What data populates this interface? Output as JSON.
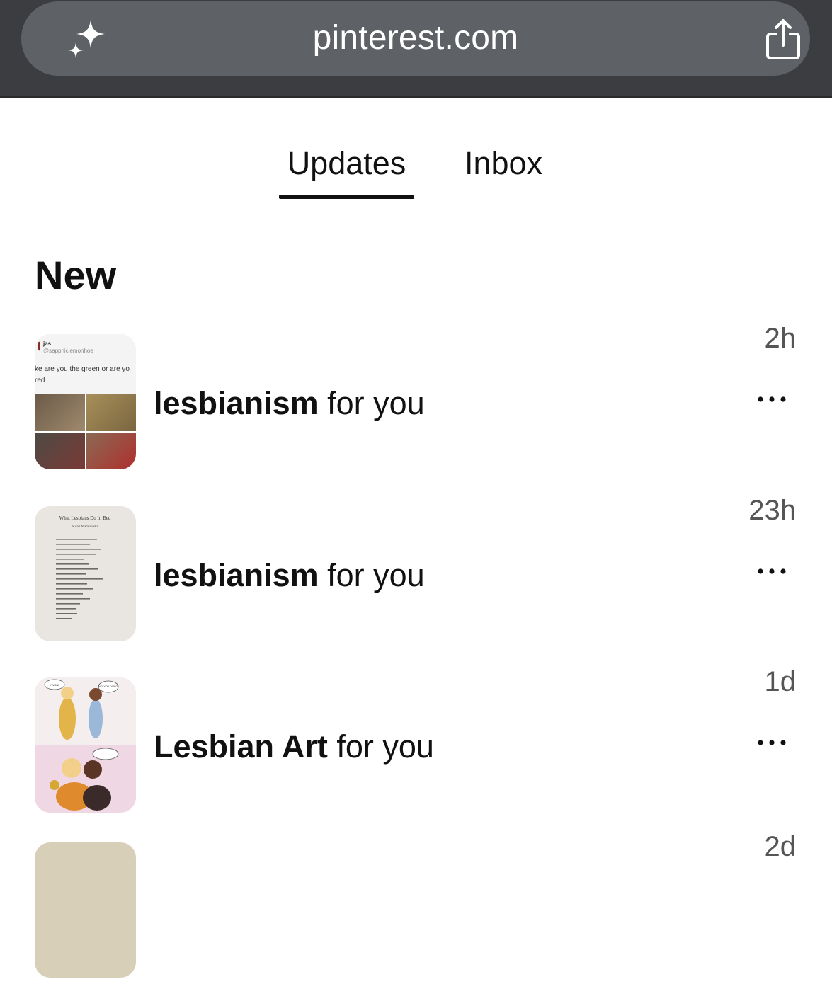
{
  "browser": {
    "url": "pinterest.com",
    "sparkle_icon": "sparkles-icon",
    "share_icon": "share-icon"
  },
  "tabs": [
    {
      "label": "Updates",
      "active": true
    },
    {
      "label": "Inbox",
      "active": false
    }
  ],
  "section": {
    "heading": "New"
  },
  "notifications": [
    {
      "board": "lesbianism",
      "suffix": "for you",
      "time": "2h"
    },
    {
      "board": "lesbianism",
      "suffix": "for you",
      "time": "23h"
    },
    {
      "board": "Lesbian Art",
      "suffix": "for you",
      "time": "1d"
    },
    {
      "time": "2d"
    }
  ],
  "thumbnails": {
    "tweet_name": "jas",
    "tweet_handle": "@sapphiclemonhoe",
    "tweet_text": "ke are you the green or are yo",
    "tweet_text2": "red",
    "poem_title": "What Lesbians Do In Bed",
    "poem_author": "Susan Matasovska",
    "comic_bubble_1": "I WON!",
    "comic_bubble_2": "NO, YOU DIDN'T"
  },
  "colors": {
    "browser_bar": "#3b3d40",
    "url_pill": "#5e6165",
    "text_primary": "#111111",
    "time_text": "#555555"
  }
}
